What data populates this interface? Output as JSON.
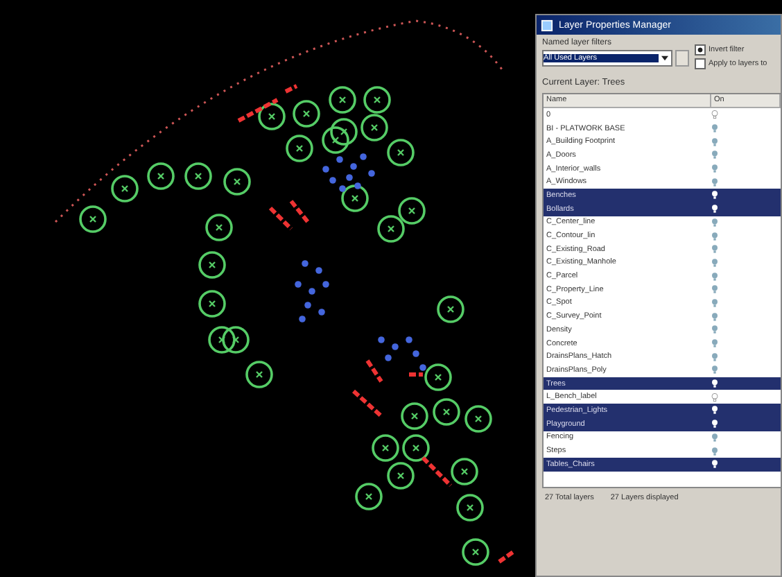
{
  "window": {
    "title": "Layer Properties Manager"
  },
  "filters": {
    "label": "Named layer filters",
    "value": "All Used Layers",
    "invert_filter": {
      "label": "Invert filter",
      "checked": true
    },
    "apply_toolbar": {
      "label": "Apply to layers to",
      "checked": false
    }
  },
  "current_layer": "Current Layer:  Trees",
  "table": {
    "columns": [
      "Name",
      "On"
    ],
    "rows": [
      {
        "name": "0",
        "on": false,
        "selected": false
      },
      {
        "name": "BI - PLATWORK BASE",
        "on": true,
        "selected": false
      },
      {
        "name": "A_Building Footprint",
        "on": true,
        "selected": false
      },
      {
        "name": "A_Doors",
        "on": true,
        "selected": false
      },
      {
        "name": "A_Interior_walls",
        "on": true,
        "selected": false
      },
      {
        "name": "A_Windows",
        "on": true,
        "selected": false
      },
      {
        "name": "Benches",
        "on": true,
        "selected": true
      },
      {
        "name": "Bollards",
        "on": true,
        "selected": true
      },
      {
        "name": "C_Center_line",
        "on": true,
        "selected": false
      },
      {
        "name": "C_Contour_lin",
        "on": true,
        "selected": false
      },
      {
        "name": "C_Existing_Road",
        "on": true,
        "selected": false
      },
      {
        "name": "C_Existing_Manhole",
        "on": true,
        "selected": false
      },
      {
        "name": "C_Parcel",
        "on": true,
        "selected": false
      },
      {
        "name": "C_Property_Line",
        "on": true,
        "selected": false
      },
      {
        "name": "C_Spot",
        "on": true,
        "selected": false
      },
      {
        "name": "C_Survey_Point",
        "on": true,
        "selected": false
      },
      {
        "name": "Density",
        "on": true,
        "selected": false
      },
      {
        "name": "Concrete",
        "on": true,
        "selected": false
      },
      {
        "name": "DrainsPlans_Hatch",
        "on": true,
        "selected": false
      },
      {
        "name": "DrainsPlans_Poly",
        "on": true,
        "selected": false
      },
      {
        "name": "Trees",
        "on": true,
        "selected": true
      },
      {
        "name": "L_Bench_label",
        "on": false,
        "selected": false
      },
      {
        "name": "Pedestrian_Lights",
        "on": true,
        "selected": true
      },
      {
        "name": "Playground",
        "on": true,
        "selected": true
      },
      {
        "name": "Fencing",
        "on": true,
        "selected": false
      },
      {
        "name": "Steps",
        "on": true,
        "selected": false
      },
      {
        "name": "Tables_Chairs",
        "on": true,
        "selected": true
      }
    ]
  },
  "status_bar": {
    "total": "27 Total layers",
    "displayed": "27 Layers displayed"
  }
}
